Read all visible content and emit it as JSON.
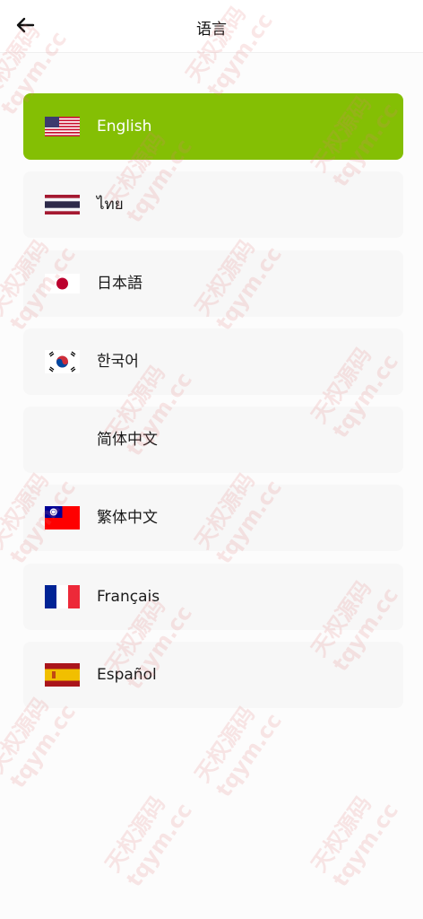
{
  "header": {
    "title": "语言",
    "back_icon": "arrow-left-icon"
  },
  "languages": [
    {
      "label": "English",
      "flag": "us-flag-icon",
      "selected": true
    },
    {
      "label": "ไทย",
      "flag": "thailand-flag-icon",
      "selected": false
    },
    {
      "label": "日本語",
      "flag": "japan-flag-icon",
      "selected": false
    },
    {
      "label": "한국어",
      "flag": "korea-flag-icon",
      "selected": false
    },
    {
      "label": "简体中文",
      "flag": "",
      "selected": false
    },
    {
      "label": "繁体中文",
      "flag": "taiwan-flag-icon",
      "selected": false
    },
    {
      "label": "Français",
      "flag": "france-flag-icon",
      "selected": false
    },
    {
      "label": "Español",
      "flag": "spain-flag-icon",
      "selected": false
    }
  ],
  "colors": {
    "accent": "#84bf04",
    "item_bg": "#f7f7f7",
    "page_bg": "#fcfcfc"
  },
  "watermark": {
    "line1": "天权源码",
    "line2": "tqym.cc"
  }
}
